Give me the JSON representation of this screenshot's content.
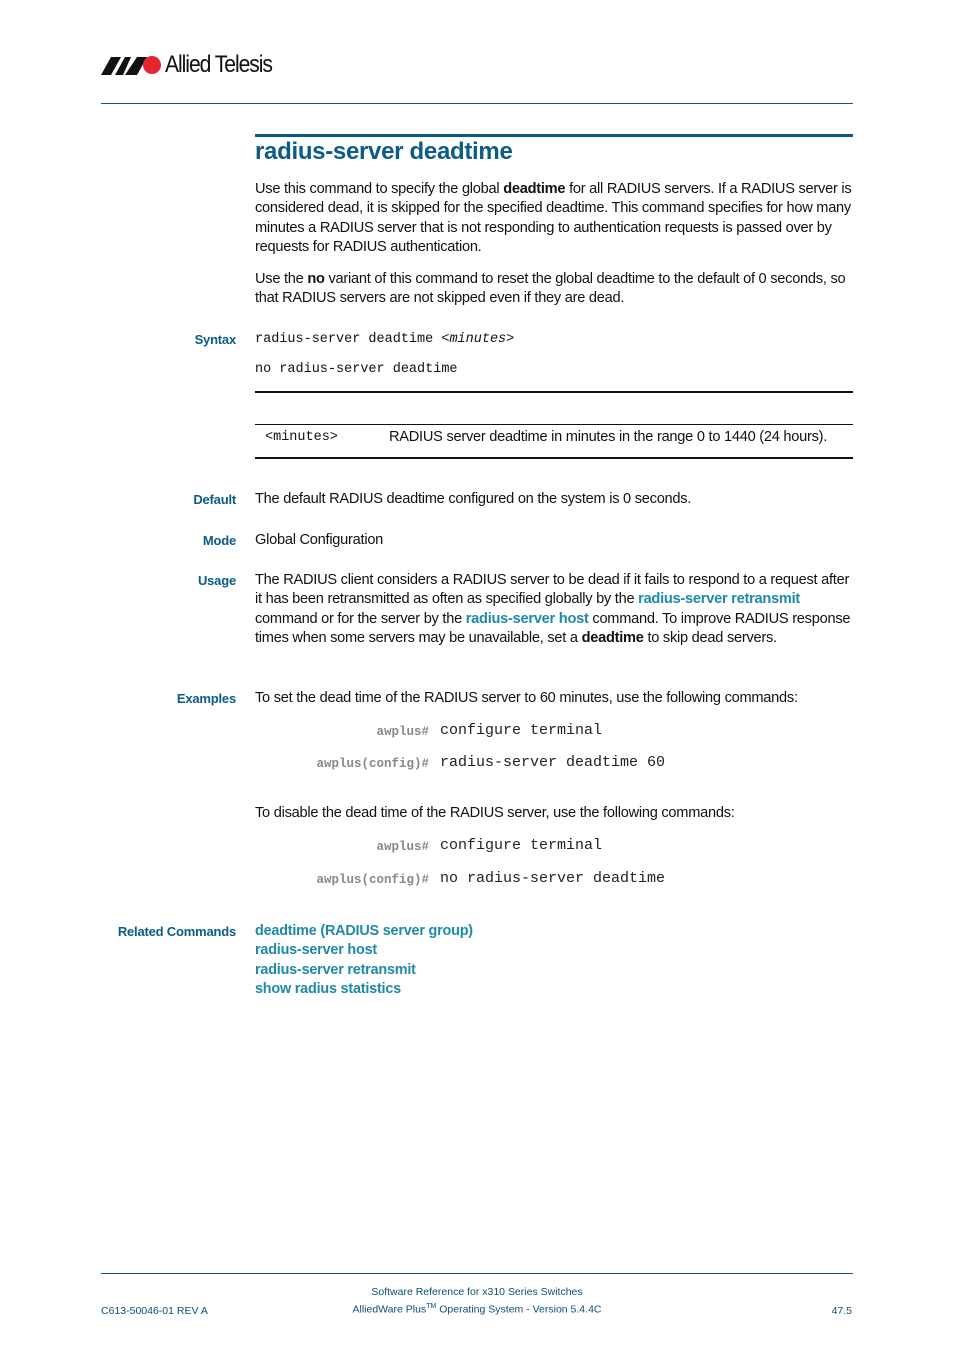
{
  "header": {
    "brand": "Allied Telesis",
    "logo_icon": "allied-telesis-logo"
  },
  "title": "radius-server deadtime",
  "intro": {
    "p1_pre": "Use this command to specify the global ",
    "p1_bold": "deadtime",
    "p1_post": " for all RADIUS servers. If a RADIUS server is considered dead, it is skipped for the specified deadtime. This command specifies for how many minutes a RADIUS server that is not responding to authentication requests is passed over by requests for RADIUS authentication.",
    "p2_pre": "Use the ",
    "p2_bold": "no",
    "p2_post": " variant of this command to reset the global deadtime to the default of 0 seconds, so that RADIUS servers are not skipped even if they are dead."
  },
  "syntax": {
    "label": "Syntax",
    "line1_cmd": "radius-server deadtime ",
    "line1_param": "<minutes>",
    "line2": "no radius-server deadtime",
    "table": [
      {
        "param": "<minutes>",
        "desc": "RADIUS server deadtime in minutes in the range 0 to 1440 (24 hours)."
      }
    ]
  },
  "default": {
    "label": "Default",
    "text": "The default RADIUS deadtime configured on the system is 0 seconds."
  },
  "mode": {
    "label": "Mode",
    "text": "Global Configuration"
  },
  "usage": {
    "label": "Usage",
    "t1": "The RADIUS client considers a RADIUS server to be dead if it fails to respond to a request after it has been retransmitted as often as specified globally by the ",
    "link1": "radius-server retransmit",
    "t2": " command or for the server by the ",
    "link2": "radius-server host",
    "t3": " command. To improve RADIUS response times when some servers may be unavailable, set a ",
    "bold": "deadtime",
    "t4": " to skip dead servers."
  },
  "examples": {
    "label": "Examples",
    "intro1": "To set the dead time of the RADIUS server to 60 minutes, use the following commands:",
    "block1": [
      {
        "prompt": "awplus#",
        "cmd": "configure terminal"
      },
      {
        "prompt": "awplus(config)#",
        "cmd": "radius-server deadtime 60"
      }
    ],
    "intro2": "To disable the dead time of the RADIUS server, use the following commands:",
    "block2": [
      {
        "prompt": "awplus#",
        "cmd": "configure terminal"
      },
      {
        "prompt": "awplus(config)#",
        "cmd": "no radius-server deadtime"
      }
    ]
  },
  "related": {
    "label": "Related Commands",
    "items": [
      "deadtime (RADIUS server group)",
      "radius-server host",
      "radius-server retransmit",
      "show radius statistics"
    ]
  },
  "footer": {
    "doc_id": "C613-50046-01 REV A",
    "line1": "Software Reference for x310 Series Switches",
    "line2_pre": "AlliedWare Plus",
    "line2_tm": "TM",
    "line2_post": " Operating System - Version 5.4.4C",
    "page": "47.5"
  },
  "colors": {
    "heading": "#0b5c86",
    "link": "#1f8aa8",
    "rule": "#0a5a83"
  }
}
